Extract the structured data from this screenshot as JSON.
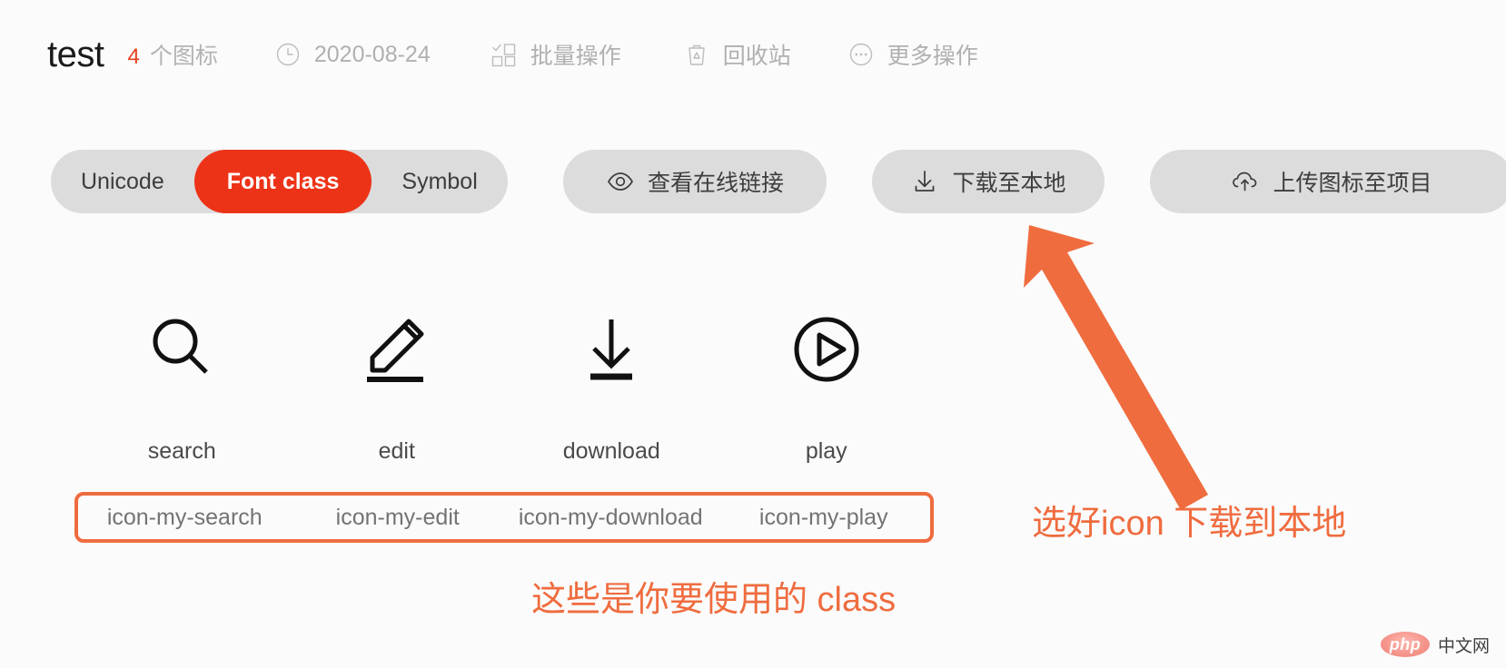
{
  "header": {
    "project_title": "test",
    "icon_count": "4",
    "icon_count_label": "个图标",
    "date": "2020-08-24",
    "date_icon": "clock-icon",
    "batch_label": "批量操作",
    "batch_icon": "batch-select-icon",
    "trash_label": "回收站",
    "trash_icon": "trash-icon",
    "more_label": "更多操作",
    "more_icon": "ellipsis-circle-icon"
  },
  "toolbar": {
    "segmented": {
      "options": [
        "Unicode",
        "Font class",
        "Symbol"
      ],
      "selected": "Font class",
      "active_bg": "#ed3317",
      "track_bg": "#dcdcdc"
    },
    "buttons": [
      {
        "id": "online",
        "label": "查看在线链接",
        "icon": "eye-icon"
      },
      {
        "id": "download",
        "label": "下载至本地",
        "icon": "download-icon"
      },
      {
        "id": "upload",
        "label": "上传图标至项目",
        "icon": "cloud-upload-icon"
      }
    ]
  },
  "icons": [
    {
      "name": "search",
      "class": "icon-my-search",
      "glyph": "magnifier-icon"
    },
    {
      "name": "edit",
      "class": "icon-my-edit",
      "glyph": "pencil-icon"
    },
    {
      "name": "download",
      "class": "icon-my-download",
      "glyph": "download-arrow-icon"
    },
    {
      "name": "play",
      "class": "icon-my-play",
      "glyph": "play-circle-icon"
    }
  ],
  "annotations": {
    "class_note": "这些是你要使用的 class",
    "download_note": "选好icon 下载到本地",
    "accent_color": "#ef6c3f"
  },
  "watermark": {
    "badge": "php",
    "text": "中文网"
  }
}
